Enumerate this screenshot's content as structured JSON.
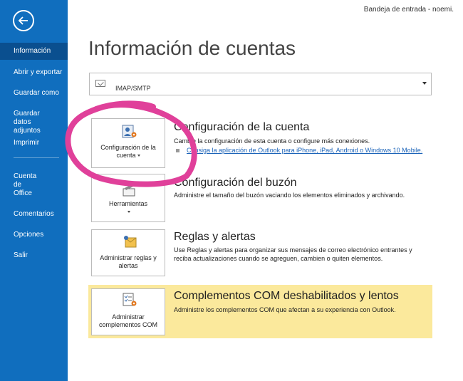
{
  "header": {
    "user_label": "Bandeja de entrada - noemi."
  },
  "sidebar": {
    "back_label": "back",
    "items": [
      {
        "label": "Información"
      },
      {
        "label": "Abrir y exportar"
      },
      {
        "label": "Guardar como"
      },
      {
        "label": "Guardar datos adjuntos"
      },
      {
        "label": "Imprimir"
      },
      {
        "label": "Cuenta de Office"
      },
      {
        "label": "Comentarios"
      },
      {
        "label": "Opciones"
      },
      {
        "label": "Salir"
      }
    ]
  },
  "main": {
    "title": "Información de cuentas",
    "account": {
      "type": "IMAP/SMTP"
    },
    "sections": [
      {
        "tile_label": "Configuración de la cuenta",
        "title": "Configuración de la cuenta",
        "description": "Cambie la configuración de esta cuenta o configure más conexiones.",
        "link": "Consiga la aplicación de Outlook para iPhone, iPad, Android o Windows 10 Mobile."
      },
      {
        "tile_label": "Herramientas",
        "title": "Configuración del buzón",
        "description": "Administre el tamaño del buzón vaciando los elementos eliminados y archivando."
      },
      {
        "tile_label": "Administrar reglas y alertas",
        "title": "Reglas y alertas",
        "description": "Use Reglas y alertas para organizar sus mensajes de correo electrónico entrantes y reciba actualizaciones cuando se agreguen, cambien o quiten elementos."
      },
      {
        "tile_label": "Administrar complementos COM",
        "title": "Complementos COM deshabilitados y lentos",
        "description": "Administre los complementos COM que afectan a su experiencia con Outlook."
      }
    ]
  },
  "colors": {
    "sidebar_bg": "#106ebe",
    "sidebar_active": "#0a4f8f",
    "highlight_bg": "#fbe99c",
    "annotation": "#e0409a",
    "link": "#1a62b8"
  },
  "icons": [
    "back-arrow-icon",
    "account-settings-icon",
    "tools-icon",
    "rules-alerts-icon",
    "com-addins-icon",
    "dropdown-caret-icon"
  ]
}
